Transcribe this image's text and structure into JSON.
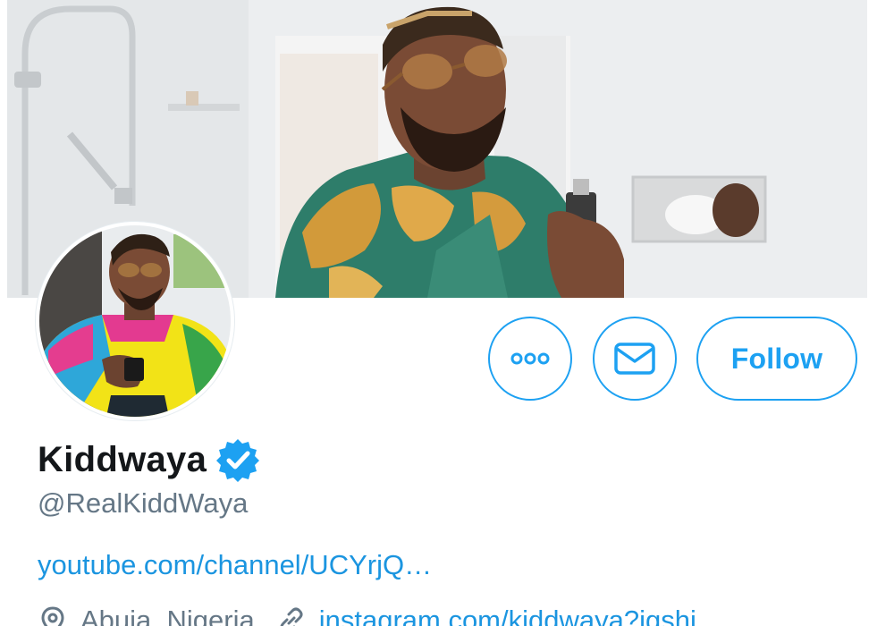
{
  "profile": {
    "display_name": "Kiddwaya",
    "handle": "@RealKiddWaya",
    "website_link": "youtube.com/channel/UCYrjQ…",
    "location": "Abuja, Nigeria",
    "secondary_link": "instagram.com/kiddwaya?igshi…"
  },
  "actions": {
    "more_label": "",
    "message_label": "",
    "follow_label": "Follow"
  },
  "icons": {
    "more": "more-horizontal-icon",
    "message": "envelope-icon",
    "verified": "verified-badge-icon",
    "location": "location-pin-icon",
    "link": "link-icon"
  },
  "colors": {
    "accent": "#1da1f2",
    "link": "#1b95e0",
    "secondary_text": "#657786",
    "primary_text": "#14171a"
  }
}
